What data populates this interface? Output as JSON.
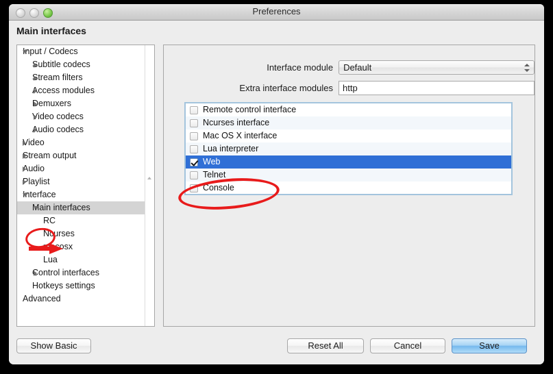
{
  "window": {
    "title": "Preferences",
    "traffic_lights": [
      "close-button",
      "minimize-button",
      "zoom-button"
    ],
    "page_title": "Main interfaces"
  },
  "sidebar": {
    "items": [
      {
        "label": "Input / Codecs",
        "level": 0,
        "disclosure": "open",
        "selected": false
      },
      {
        "label": "Subtitle codecs",
        "level": 1,
        "disclosure": "closed",
        "selected": false
      },
      {
        "label": "Stream filters",
        "level": 1,
        "disclosure": "closed",
        "selected": false
      },
      {
        "label": "Access modules",
        "level": 1,
        "disclosure": "closed",
        "selected": false
      },
      {
        "label": "Demuxers",
        "level": 1,
        "disclosure": "closed",
        "selected": false
      },
      {
        "label": "Video codecs",
        "level": 1,
        "disclosure": "closed",
        "selected": false
      },
      {
        "label": "Audio codecs",
        "level": 1,
        "disclosure": "closed",
        "selected": false
      },
      {
        "label": "Video",
        "level": 0,
        "disclosure": "closed",
        "selected": false
      },
      {
        "label": "Stream output",
        "level": 0,
        "disclosure": "closed",
        "selected": false
      },
      {
        "label": "Audio",
        "level": 0,
        "disclosure": "closed",
        "selected": false
      },
      {
        "label": "Playlist",
        "level": 0,
        "disclosure": "closed",
        "selected": false
      },
      {
        "label": "Interface",
        "level": 0,
        "disclosure": "open",
        "selected": false
      },
      {
        "label": "Main interfaces",
        "level": 1,
        "disclosure": "open",
        "selected": true
      },
      {
        "label": "RC",
        "level": 2,
        "disclosure": "none",
        "selected": false
      },
      {
        "label": "Ncurses",
        "level": 2,
        "disclosure": "none",
        "selected": false
      },
      {
        "label": "macosx",
        "level": 2,
        "disclosure": "none",
        "selected": false
      },
      {
        "label": "Lua",
        "level": 2,
        "disclosure": "none",
        "selected": false
      },
      {
        "label": "Control interfaces",
        "level": 1,
        "disclosure": "closed",
        "selected": false
      },
      {
        "label": "Hotkeys settings",
        "level": 1,
        "disclosure": "none",
        "selected": false
      },
      {
        "label": "Advanced",
        "level": 0,
        "disclosure": "none",
        "selected": false
      }
    ]
  },
  "panel": {
    "interface_module": {
      "label": "Interface module",
      "value": "Default"
    },
    "extra_interface_modules": {
      "label": "Extra interface modules",
      "value": "http",
      "placeholder": ""
    },
    "module_list": [
      {
        "label": "Remote control interface",
        "checked": false,
        "selected": false
      },
      {
        "label": "Ncurses interface",
        "checked": false,
        "selected": false
      },
      {
        "label": "Mac OS X interface",
        "checked": false,
        "selected": false
      },
      {
        "label": "Lua interpreter",
        "checked": false,
        "selected": false
      },
      {
        "label": "Web",
        "checked": true,
        "selected": true
      },
      {
        "label": "Telnet",
        "checked": false,
        "selected": false
      },
      {
        "label": "Console",
        "checked": false,
        "selected": false
      }
    ]
  },
  "buttons": {
    "show_basic": "Show Basic",
    "reset_all": "Reset All",
    "cancel": "Cancel",
    "save": "Save"
  },
  "annotations": {
    "ellipse_web": "red-ellipse-around-web-row",
    "ellipse_interface": "red-ellipse-around-interface-disclosure",
    "arrow_main_interfaces": "red-arrow-pointing-to-main-interfaces"
  },
  "colors": {
    "selection_blue": "#2f6fd6",
    "default_button_blue": "#76b9ee",
    "annotation_red": "#e81b1b",
    "window_chrome": "#ededed"
  }
}
